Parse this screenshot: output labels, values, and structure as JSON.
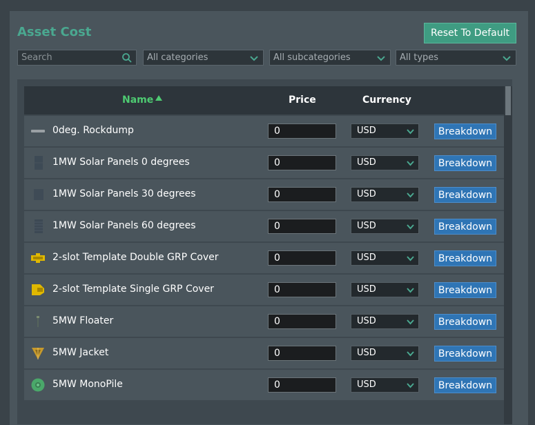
{
  "header": {
    "title": "Asset Cost",
    "reset_label": "Reset To Default"
  },
  "filters": {
    "search_placeholder": "Search",
    "categories": "All categories",
    "subcategories": "All subcategories",
    "types": "All types"
  },
  "columns": {
    "name": "Name",
    "price": "Price",
    "currency": "Currency"
  },
  "colors": {
    "accent": "#3f9c82",
    "title": "#4aa890",
    "sort_header": "#4ecb72",
    "button": "#2f75b5"
  },
  "rows": [
    {
      "name": "0deg. Rockdump",
      "price": "0",
      "currency": "USD",
      "action": "Breakdown",
      "icon": "rockdump-icon"
    },
    {
      "name": "1MW Solar Panels 0 degrees",
      "price": "0",
      "currency": "USD",
      "action": "Breakdown",
      "icon": "solar-panel-icon"
    },
    {
      "name": "1MW Solar Panels 30 degrees",
      "price": "0",
      "currency": "USD",
      "action": "Breakdown",
      "icon": "solar-panel-icon"
    },
    {
      "name": "1MW Solar Panels 60 degrees",
      "price": "0",
      "currency": "USD",
      "action": "Breakdown",
      "icon": "solar-panel-icon"
    },
    {
      "name": "2-slot Template Double GRP Cover",
      "price": "0",
      "currency": "USD",
      "action": "Breakdown",
      "icon": "template-double-icon"
    },
    {
      "name": "2-slot Template Single GRP Cover",
      "price": "0",
      "currency": "USD",
      "action": "Breakdown",
      "icon": "template-single-icon"
    },
    {
      "name": "5MW Floater",
      "price": "0",
      "currency": "USD",
      "action": "Breakdown",
      "icon": "floater-icon"
    },
    {
      "name": "5MW Jacket",
      "price": "0",
      "currency": "USD",
      "action": "Breakdown",
      "icon": "jacket-icon"
    },
    {
      "name": "5MW MonoPile",
      "price": "0",
      "currency": "USD",
      "action": "Breakdown",
      "icon": "monopile-icon"
    }
  ]
}
